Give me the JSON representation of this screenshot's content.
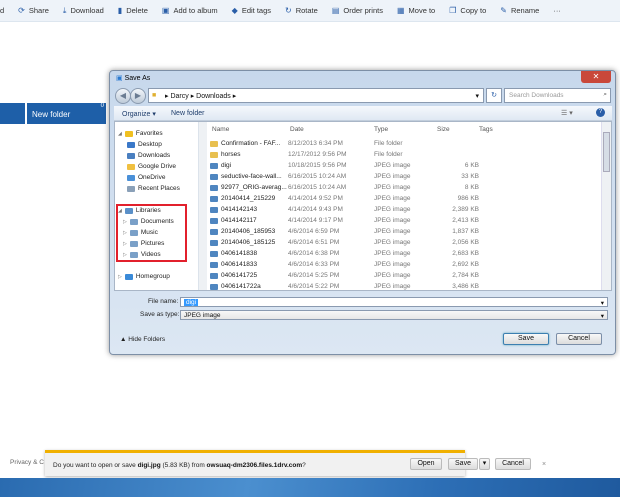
{
  "toolbar": {
    "items": [
      {
        "label": "Share",
        "icon": "share-icon"
      },
      {
        "label": "Download",
        "icon": "download-icon"
      },
      {
        "label": "Delete",
        "icon": "trash-icon"
      },
      {
        "label": "Add to album",
        "icon": "album-icon"
      },
      {
        "label": "Edit tags",
        "icon": "tag-icon"
      },
      {
        "label": "Rotate",
        "icon": "rotate-icon"
      },
      {
        "label": "Order prints",
        "icon": "print-icon"
      },
      {
        "label": "Move to",
        "icon": "move-icon"
      },
      {
        "label": "Copy to",
        "icon": "copy-icon"
      },
      {
        "label": "Rename",
        "icon": "rename-icon"
      }
    ],
    "more": "···",
    "cut_left": "d"
  },
  "page": {
    "new_folder": "New folder",
    "badge": "0",
    "footer": "Privacy & C"
  },
  "dialog": {
    "title": "Save As",
    "breadcrumb": [
      "Darcy",
      "Downloads"
    ],
    "search_placeholder": "Search Downloads",
    "organize": "Organize ▾",
    "new_folder": "New folder",
    "nav": {
      "favorites": "Favorites",
      "fav_items": [
        "Desktop",
        "Downloads",
        "Google Drive",
        "OneDrive",
        "Recent Places"
      ],
      "libraries": "Libraries",
      "lib_items": [
        "Documents",
        "Music",
        "Pictures",
        "Videos"
      ],
      "homegroup": "Homegroup"
    },
    "columns": {
      "name": "Name",
      "date": "Date",
      "type": "Type",
      "size": "Size",
      "tags": "Tags"
    },
    "files": [
      {
        "name": "Confirmation - FAF...",
        "date": "8/12/2013 6:34 PM",
        "type": "File folder",
        "size": "",
        "kind": "folder"
      },
      {
        "name": "horses",
        "date": "12/17/2012 9:56 PM",
        "type": "File folder",
        "size": "",
        "kind": "folder"
      },
      {
        "name": "digi",
        "date": "10/18/2015 9:56 PM",
        "type": "JPEG image",
        "size": "6 KB",
        "kind": "image"
      },
      {
        "name": "seductive-face-wall...",
        "date": "6/16/2015 10:24 AM",
        "type": "JPEG image",
        "size": "33 KB",
        "kind": "image"
      },
      {
        "name": "92977_ORIG-averag...",
        "date": "6/16/2015 10:24 AM",
        "type": "JPEG image",
        "size": "8 KB",
        "kind": "image"
      },
      {
        "name": "20140414_215229",
        "date": "4/14/2014 9:52 PM",
        "type": "JPEG image",
        "size": "986 KB",
        "kind": "image"
      },
      {
        "name": "0414142143",
        "date": "4/14/2014 9:43 PM",
        "type": "JPEG image",
        "size": "2,389 KB",
        "kind": "image"
      },
      {
        "name": "0414142117",
        "date": "4/14/2014 9:17 PM",
        "type": "JPEG image",
        "size": "2,413 KB",
        "kind": "image"
      },
      {
        "name": "20140406_185953",
        "date": "4/6/2014 6:59 PM",
        "type": "JPEG image",
        "size": "1,837 KB",
        "kind": "image"
      },
      {
        "name": "20140406_185125",
        "date": "4/6/2014 6:51 PM",
        "type": "JPEG image",
        "size": "2,056 KB",
        "kind": "image"
      },
      {
        "name": "0406141838",
        "date": "4/6/2014 6:38 PM",
        "type": "JPEG image",
        "size": "2,683 KB",
        "kind": "image"
      },
      {
        "name": "0406141833",
        "date": "4/6/2014 6:33 PM",
        "type": "JPEG image",
        "size": "2,692 KB",
        "kind": "image"
      },
      {
        "name": "0406141725",
        "date": "4/6/2014 5:25 PM",
        "type": "JPEG image",
        "size": "2,784 KB",
        "kind": "image"
      },
      {
        "name": "0406141722a",
        "date": "4/6/2014 5:22 PM",
        "type": "JPEG image",
        "size": "3,486 KB",
        "kind": "image"
      }
    ],
    "file_name_label": "File name:",
    "file_name_value": "digi",
    "save_type_label": "Save as type:",
    "save_type_value": "JPEG image",
    "hide_folders": "Hide Folders",
    "save": "Save",
    "cancel": "Cancel"
  },
  "notification": {
    "prefix": "Do you want to open or save ",
    "file": "digi.jpg",
    "size": " (5.83 KB) from ",
    "host": "owsuaq-dm2306.files.1drv.com",
    "suffix": "?",
    "open": "Open",
    "save": "Save",
    "cancel": "Cancel",
    "close": "×"
  },
  "colors": {
    "accent": "#1e5fa8",
    "highlight_box": "#e2202c",
    "notif_bar": "#f0b000"
  }
}
